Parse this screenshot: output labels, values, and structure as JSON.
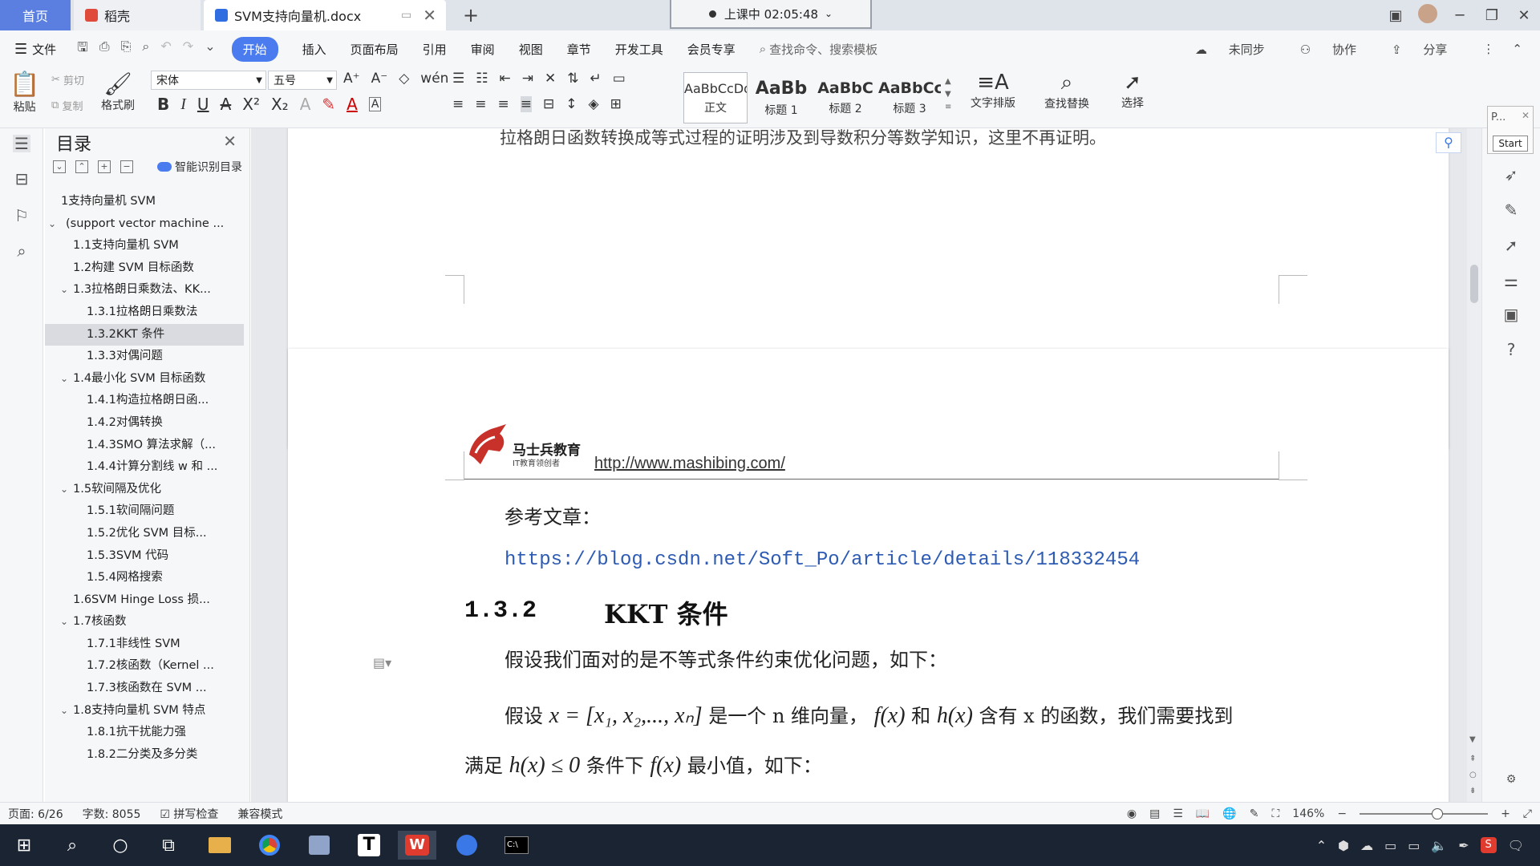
{
  "tabs": {
    "home": "首页",
    "daoke": "稻壳",
    "doc": "SVM支持向量机.docx"
  },
  "class_status": "上课中 02:05:48",
  "menu": {
    "file": "文件",
    "items": [
      "开始",
      "插入",
      "页面布局",
      "引用",
      "审阅",
      "视图",
      "章节",
      "开发工具",
      "会员专享"
    ],
    "search": "查找命令、搜索模板",
    "sync": "未同步",
    "collab": "协作",
    "share": "分享"
  },
  "ribbon": {
    "paste": "粘贴",
    "cut": "剪切",
    "copy": "复制",
    "format_painter": "格式刷",
    "font_name": "宋体",
    "font_size": "五号",
    "styles": [
      {
        "sample": "AaBbCcDd",
        "name": "正文"
      },
      {
        "sample": "AaBb",
        "name": "标题 1"
      },
      {
        "sample": "AaBbC",
        "name": "标题 2"
      },
      {
        "sample": "AaBbCc",
        "name": "标题 3"
      }
    ],
    "text_layout": "文字排版",
    "find_replace": "查找替换",
    "select": "选择"
  },
  "toc": {
    "title": "目录",
    "smart": "智能识别目录",
    "items": [
      {
        "label": "1支持向量机 SVM",
        "level": 0,
        "arrow": ""
      },
      {
        "label": "(support vector machine ...",
        "level": 0,
        "arrow": "v"
      },
      {
        "label": "1.1支持向量机 SVM",
        "level": 1,
        "arrow": ""
      },
      {
        "label": "1.2构建 SVM 目标函数",
        "level": 1,
        "arrow": ""
      },
      {
        "label": "1.3拉格朗日乘数法、KK...",
        "level": 1,
        "arrow": "v"
      },
      {
        "label": "1.3.1拉格朗日乘数法",
        "level": 2,
        "arrow": ""
      },
      {
        "label": "1.3.2KKT 条件",
        "level": 2,
        "arrow": "",
        "selected": true
      },
      {
        "label": "1.3.3对偶问题",
        "level": 2,
        "arrow": ""
      },
      {
        "label": "1.4最小化 SVM 目标函数",
        "level": 1,
        "arrow": "v"
      },
      {
        "label": "1.4.1构造拉格朗日函...",
        "level": 2,
        "arrow": ""
      },
      {
        "label": "1.4.2对偶转换",
        "level": 2,
        "arrow": ""
      },
      {
        "label": "1.4.3SMO 算法求解（...",
        "level": 2,
        "arrow": ""
      },
      {
        "label": "1.4.4计算分割线 w 和 ...",
        "level": 2,
        "arrow": ""
      },
      {
        "label": "1.5软间隔及优化",
        "level": 1,
        "arrow": "v"
      },
      {
        "label": "1.5.1软间隔问题",
        "level": 2,
        "arrow": ""
      },
      {
        "label": "1.5.2优化 SVM 目标...",
        "level": 2,
        "arrow": ""
      },
      {
        "label": "1.5.3SVM 代码",
        "level": 2,
        "arrow": ""
      },
      {
        "label": "1.5.4网格搜索",
        "level": 2,
        "arrow": ""
      },
      {
        "label": "1.6SVM Hinge Loss 损...",
        "level": 1,
        "arrow": ""
      },
      {
        "label": "1.7核函数",
        "level": 1,
        "arrow": "v"
      },
      {
        "label": "1.7.1非线性 SVM",
        "level": 2,
        "arrow": ""
      },
      {
        "label": "1.7.2核函数（Kernel ...",
        "level": 2,
        "arrow": ""
      },
      {
        "label": "1.7.3核函数在 SVM ...",
        "level": 2,
        "arrow": ""
      },
      {
        "label": "1.8支持向量机 SVM 特点",
        "level": 1,
        "arrow": "v"
      },
      {
        "label": "1.8.1抗干扰能力强",
        "level": 2,
        "arrow": ""
      },
      {
        "label": "1.8.2二分类及多分类",
        "level": 2,
        "arrow": ""
      }
    ]
  },
  "document": {
    "prev_page_text": "拉格朗日函数转换成等式过程的证明涉及到导数积分等数学知识，这里不再证明。",
    "header_brand": "马士兵教育",
    "header_tagline": "IT教育领创者",
    "header_url": "http://www.mashibing.com/",
    "ref_label": "参考文章：",
    "ref_link": "https://blog.csdn.net/Soft_Po/article/details/118332454",
    "heading_num": "1.3.2",
    "heading_text": "KKT 条件",
    "para1": "假设我们面对的是不等式条件约束优化问题，如下：",
    "para2_prefix": "假设",
    "para2_math1": "x = [x₁, x₂,..., xₙ]",
    "para2_mid": "是一个 n 维向量，",
    "para2_math2": "f(x)",
    "para2_and": "和",
    "para2_math3": "h(x)",
    "para2_suffix": "含有 x 的函数，我们需要找到",
    "para3_prefix": "满足",
    "para3_math1": "h(x) ≤ 0",
    "para3_mid": "条件下",
    "para3_math2": "f(x)",
    "para3_suffix": "最小值，如下："
  },
  "rightbar": {
    "p_label": "P...",
    "start": "Start"
  },
  "status": {
    "page": "页面: 6/26",
    "words": "字数: 8055",
    "spell": "拼写检查",
    "compat": "兼容模式",
    "zoom": "146%"
  },
  "colors": {
    "accent": "#4a7cf0",
    "home_tab": "#5b7fe0",
    "link": "#2d5bb3",
    "taskbar": "#1b2433"
  }
}
